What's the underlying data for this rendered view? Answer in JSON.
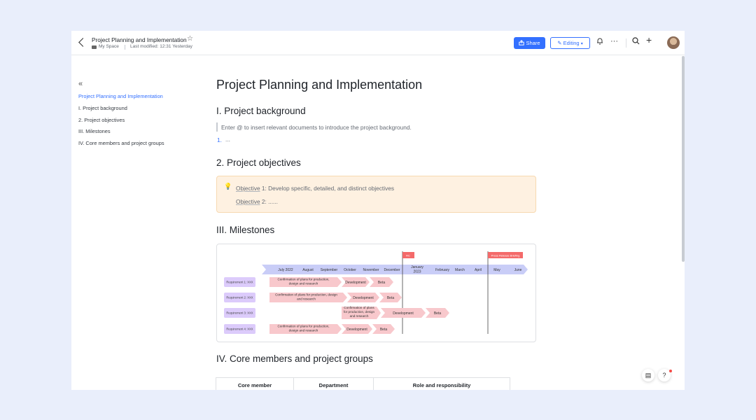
{
  "header": {
    "doc_title": "Project Planning and Implementation",
    "space": "My Space",
    "last_modified": "Last modified: 12:31 Yesterday",
    "share_label": "Share",
    "editing_label": "Editing"
  },
  "toc": {
    "items": [
      {
        "label": "Project Planning and Implementation",
        "active": true
      },
      {
        "label": "I. Project background"
      },
      {
        "label": "2. Project objectives"
      },
      {
        "label": "III. Milestones"
      },
      {
        "label": "IV. Core members and project groups"
      }
    ]
  },
  "doc": {
    "title": "Project Planning and Implementation",
    "section1": {
      "heading": "I. Project background",
      "quote": "Enter @ to insert relevant documents to introduce the project background.",
      "list_num": "1.",
      "list_text": "..."
    },
    "section2": {
      "heading": "2. Project objectives",
      "obj1_label": "Objective",
      "obj1_rest": " 1: Develop specific, detailed, and distinct objectives",
      "obj2_label": "Objective",
      "obj2_rest": " 2: ......"
    },
    "section3": {
      "heading": "III. Milestones"
    },
    "section4": {
      "heading": "IV. Core members and project groups",
      "table_headers": [
        "Core member",
        "Department",
        "Role and responsibility"
      ]
    }
  },
  "gantt": {
    "months": [
      "July 2022",
      "August",
      "September",
      "October",
      "November",
      "December",
      "January 2023",
      "February",
      "March",
      "April",
      "May",
      "June"
    ],
    "flags": [
      "RC",
      "Press Release Briefing"
    ],
    "requirements": [
      {
        "label": "Requirement 1: XXX",
        "tasks": [
          "Confirmation of plans for production, design and research",
          "Development",
          "Beta"
        ]
      },
      {
        "label": "Requirement 2: XXX",
        "tasks": [
          "Confirmation of plans for production, design and research",
          "Development",
          "Beta"
        ]
      },
      {
        "label": "Requirement 3: XXX",
        "tasks": [
          "Confirmation of plans for production, design and research",
          "Development",
          "Beta"
        ]
      },
      {
        "label": "Requirement 4: XXX",
        "tasks": [
          "Confirmation of plans for production, design and research",
          "Development",
          "Beta"
        ]
      }
    ]
  },
  "colors": {
    "accent": "#3370ff",
    "month_band": "#c9cdf7",
    "task_fill": "#f8c8cc",
    "req_tag": "#dccbfb",
    "flag": "#f46a6a",
    "callout_bg": "#fef1e1"
  },
  "icons": [
    "chevron-left-icon",
    "star-icon",
    "folder-icon",
    "share-icon",
    "pencil-icon",
    "chevron-down-icon",
    "bell-icon",
    "more-icon",
    "search-icon",
    "plus-icon",
    "collapse-icon",
    "bulb-icon",
    "comment-icon",
    "help-icon"
  ]
}
